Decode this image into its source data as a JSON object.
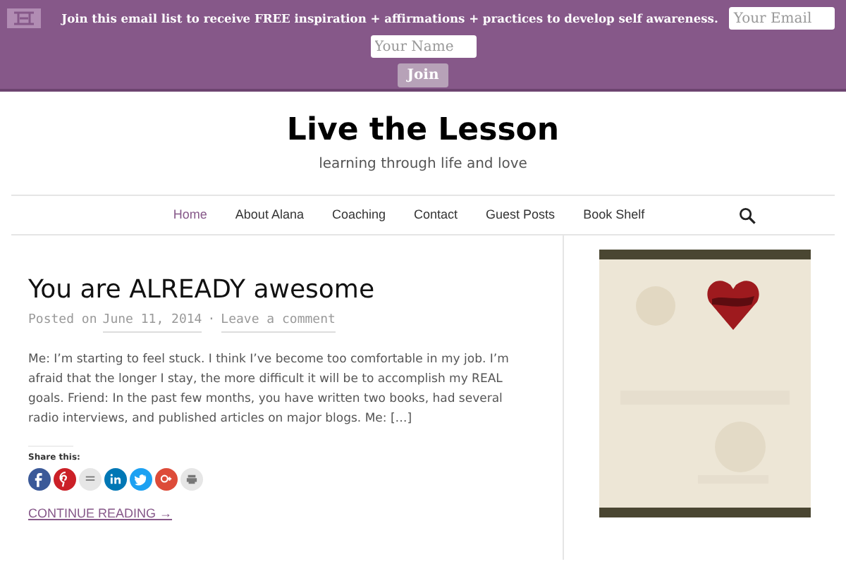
{
  "signup_bar": {
    "message": "Join this email list to receive FREE inspiration + affirmations + practices to develop self awareness.",
    "email_placeholder": "Your Email",
    "name_placeholder": "Your Name",
    "button": "Join"
  },
  "header": {
    "title": "Live the Lesson",
    "tagline": "learning through life and love"
  },
  "nav": [
    {
      "label": "Home",
      "selected": true
    },
    {
      "label": "About Alana",
      "selected": false
    },
    {
      "label": "Coaching",
      "selected": false
    },
    {
      "label": "Contact",
      "selected": false
    },
    {
      "label": "Guest Posts",
      "selected": false
    },
    {
      "label": "Book Shelf",
      "selected": false
    }
  ],
  "post": {
    "title": "You are ALREADY awesome",
    "posted_on": "Posted on",
    "date": "June 11, 2014",
    "separator": "·",
    "comment_link": "Leave a comment",
    "excerpt": "Me: I’m starting to feel stuck. I think I’ve become too comfortable in my job. I’m afraid that the longer I stay, the more difficult it will be to accomplish my REAL goals. Friend: In the past few months, you have written two books, had several radio interviews, and published articles on major blogs. Me: […]",
    "share_label": "Share this:",
    "share_buttons": [
      {
        "kind": "facebook",
        "color": "#3b5998"
      },
      {
        "kind": "pinterest",
        "color": "#cb2027"
      },
      {
        "kind": "email",
        "color": "#e6e6e6"
      },
      {
        "kind": "linkedin",
        "color": "#0077b5"
      },
      {
        "kind": "twitter",
        "color": "#1da1f2"
      },
      {
        "kind": "googleplus",
        "color": "#dd4b39"
      },
      {
        "kind": "print",
        "color": "#e6e6e6"
      }
    ],
    "continue_link": "CONTINUE READING →"
  }
}
